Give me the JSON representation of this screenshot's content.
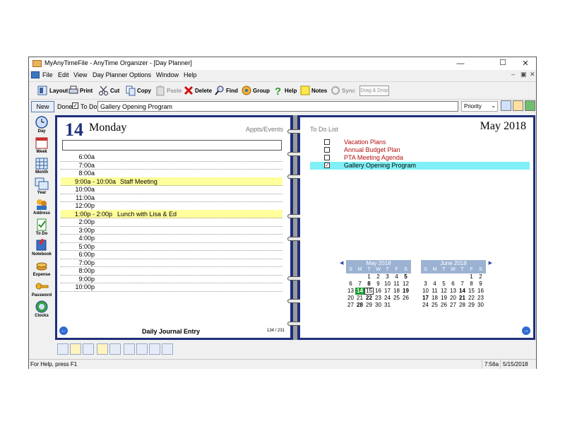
{
  "window": {
    "title": "MyAnyTimeFile - AnyTime Organizer - [Day Planner]"
  },
  "menu": [
    "File",
    "Edit",
    "View",
    "Day Planner",
    "Options",
    "Window",
    "Help"
  ],
  "toolbar": {
    "layout": "Layout",
    "print": "Print",
    "cut": "Cut",
    "copy": "Copy",
    "paste": "Paste",
    "delete": "Delete",
    "find": "Find",
    "group": "Group",
    "help": "Help",
    "notes": "Notes",
    "sync": "Sync",
    "dragdrop": "Drag & Drop"
  },
  "entry": {
    "new_label": "New",
    "done_label": "Done",
    "todo_label": "To Do",
    "todo_checked": true,
    "value": "Gallery Opening Program",
    "priority": "Priority"
  },
  "leftbar": [
    "Day",
    "Week",
    "Month",
    "Year",
    "Address",
    "To Do",
    "Notebook",
    "Expense",
    "Password",
    "Clocks"
  ],
  "dayplanner": {
    "day_number": "14",
    "day_name": "Monday",
    "appts_label": "Appts/Events",
    "slots": [
      {
        "time": "6:00a",
        "event": ""
      },
      {
        "time": "7:00a",
        "event": ""
      },
      {
        "time": "8:00a",
        "event": ""
      },
      {
        "time": "9:00a - 10:00a",
        "event": "Staff Meeting",
        "highlight": true
      },
      {
        "time": "10:00a",
        "event": ""
      },
      {
        "time": "11:00a",
        "event": ""
      },
      {
        "time": "12:00p",
        "event": ""
      },
      {
        "time": "1:00p - 2:00p",
        "event": "Lunch with Lisa & Ed",
        "highlight": true
      },
      {
        "time": "2:00p",
        "event": ""
      },
      {
        "time": "3:00p",
        "event": ""
      },
      {
        "time": "4:00p",
        "event": ""
      },
      {
        "time": "5:00p",
        "event": ""
      },
      {
        "time": "6:00p",
        "event": ""
      },
      {
        "time": "7:00p",
        "event": ""
      },
      {
        "time": "8:00p",
        "event": ""
      },
      {
        "time": "9:00p",
        "event": ""
      },
      {
        "time": "10:00p",
        "event": ""
      }
    ],
    "journal_label": "Daily Journal Entry",
    "page_number": "134 / 231"
  },
  "todo": {
    "header": "To Do List",
    "month_title": "May 2018",
    "items": [
      {
        "text": "Vacation Plans",
        "checked": false,
        "selected": false
      },
      {
        "text": "Annual Budget Plan",
        "checked": false,
        "selected": false
      },
      {
        "text": "PTA Meeting Agenda",
        "checked": false,
        "selected": false
      },
      {
        "text": "Gallery Opening Program",
        "checked": true,
        "selected": true
      }
    ]
  },
  "calendars": [
    {
      "title": "May 2018",
      "days": [
        "S",
        "M",
        "T",
        "W",
        "T",
        "F",
        "S"
      ],
      "weeks": [
        [
          "",
          "",
          "1",
          "2",
          "3",
          "4",
          "5"
        ],
        [
          "6",
          "7",
          "8",
          "9",
          "10",
          "11",
          "12"
        ],
        [
          "13",
          "14",
          "15",
          "16",
          "17",
          "18",
          "19"
        ],
        [
          "20",
          "21",
          "22",
          "23",
          "24",
          "25",
          "26"
        ],
        [
          "27",
          "28",
          "29",
          "30",
          "31",
          "",
          ""
        ]
      ],
      "bold": [
        "5",
        "8",
        "19",
        "22",
        "28"
      ],
      "today": "14",
      "boxed": "15"
    },
    {
      "title": "June 2018",
      "days": [
        "S",
        "M",
        "T",
        "W",
        "T",
        "F",
        "S"
      ],
      "weeks": [
        [
          "",
          "",
          "",
          "",
          "",
          "1",
          "2"
        ],
        [
          "3",
          "4",
          "5",
          "6",
          "7",
          "8",
          "9"
        ],
        [
          "10",
          "11",
          "12",
          "13",
          "14",
          "15",
          "16"
        ],
        [
          "17",
          "18",
          "19",
          "20",
          "21",
          "22",
          "23"
        ],
        [
          "24",
          "25",
          "26",
          "27",
          "28",
          "29",
          "30"
        ]
      ],
      "bold": [
        "14",
        "17",
        "21"
      ],
      "today": "",
      "boxed": ""
    }
  ],
  "status": {
    "help": "For Help, press F1",
    "time": "7:56a",
    "date": "5/15/2018"
  },
  "colors": {
    "book": "#1f2f7a",
    "highlight": "#ffff9c",
    "todo_text": "#b01010",
    "selected": "#7ff0f5",
    "today": "#1f9a33"
  }
}
